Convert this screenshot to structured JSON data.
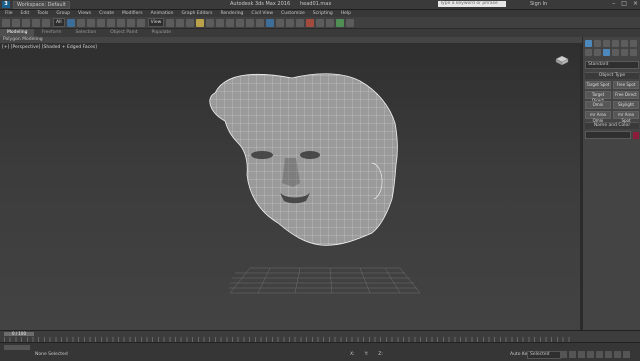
{
  "titlebar": {
    "workspace": "Workspace: Default",
    "app_title": "Autodesk 3ds Max 2016",
    "file_name": "head01.max",
    "search_placeholder": "Type a keyword or phrase",
    "sign_in": "Sign In"
  },
  "menu": [
    "File",
    "Edit",
    "Tools",
    "Group",
    "Views",
    "Create",
    "Modifiers",
    "Animation",
    "Graph Editors",
    "Rendering",
    "Civil View",
    "Customize",
    "Scripting",
    "Help"
  ],
  "toolbar": {
    "selection_filter": "All",
    "reference_coord": "View"
  },
  "ribbon": {
    "tabs": [
      "Modeling",
      "Freeform",
      "Selection",
      "Object Paint",
      "Populate"
    ],
    "active": "Modeling",
    "panel_label": "Polygon Modeling"
  },
  "viewport": {
    "label": "[+] [Perspective] [Shaded + Edged Faces]"
  },
  "command_panel": {
    "category": "Standard",
    "object_type_header": "Object Type",
    "buttons": [
      "Target Spot",
      "Free Spot",
      "Target Direct",
      "Free Direct",
      "Omni",
      "Skylight",
      "mr Area Omni",
      "mr Area Spot"
    ],
    "name_color_header": "Name and Color"
  },
  "timeline": {
    "slider_label": "0 / 100"
  },
  "statusbar": {
    "message": "None Selected",
    "auto_key_label": "Auto Key",
    "selected_label": "Selected"
  },
  "colors": {
    "accent": "#3d6e99",
    "object_color": "#8c1d3a"
  }
}
